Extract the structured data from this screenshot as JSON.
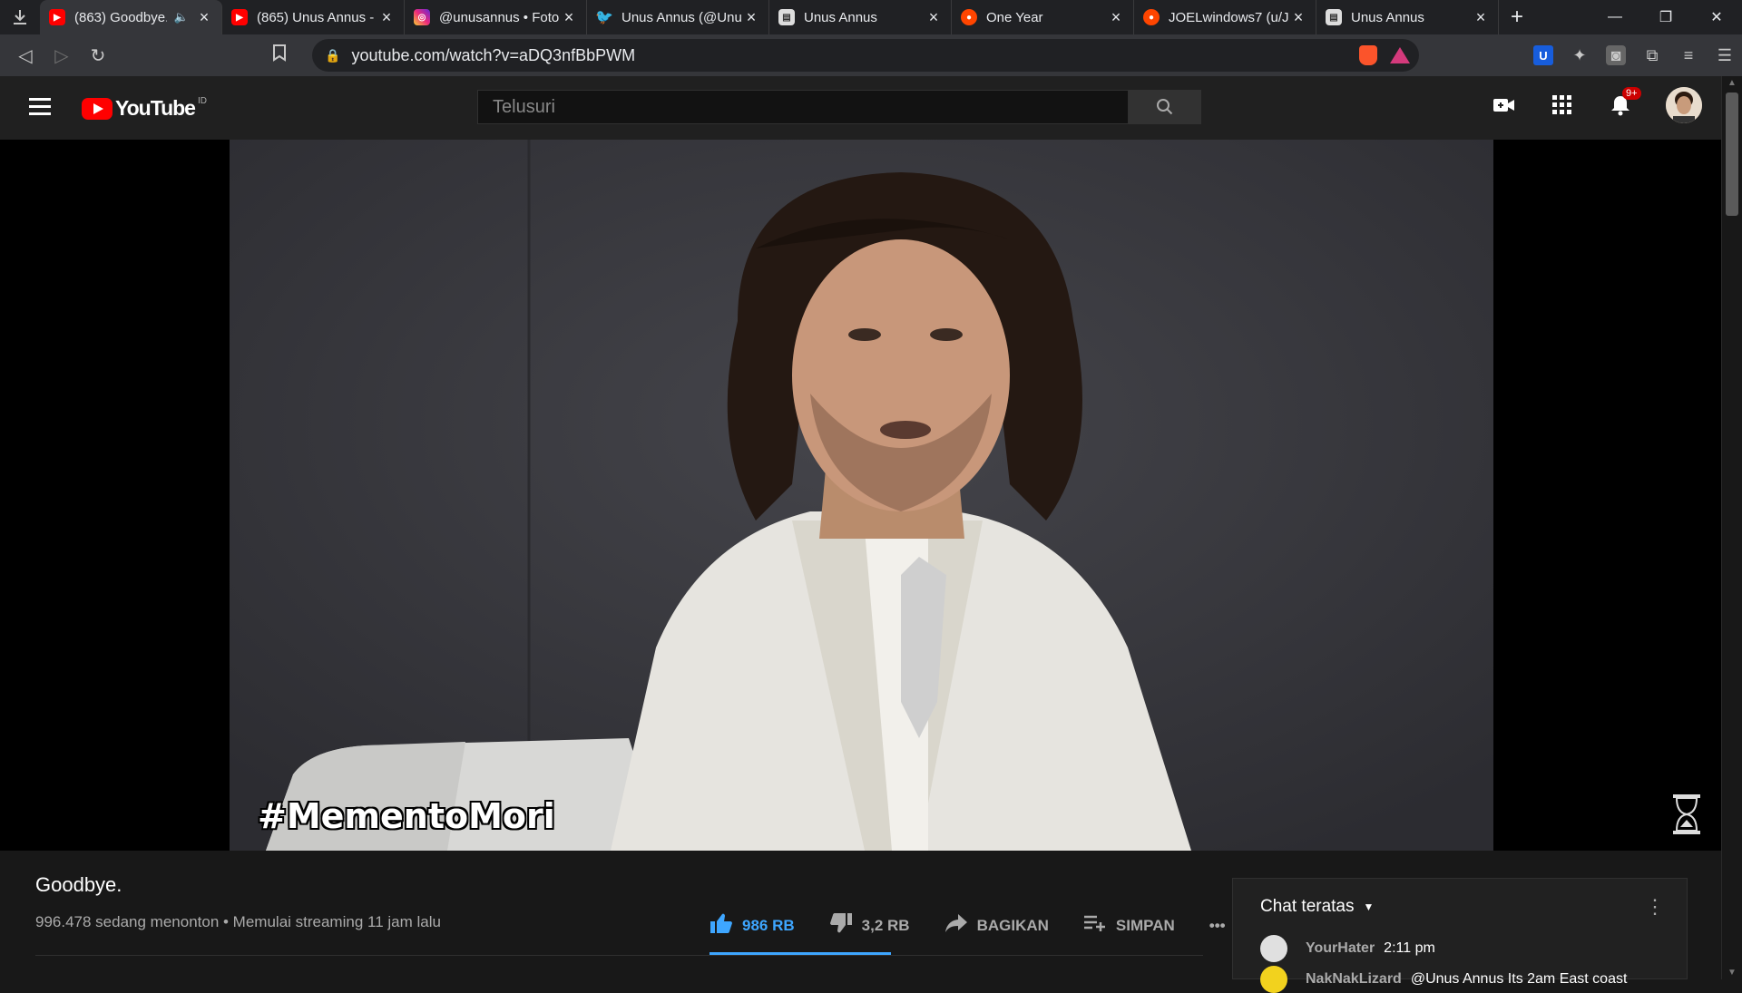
{
  "browser": {
    "tabs": [
      {
        "title": "(863) Goodbye.",
        "favicon": "youtube-icon",
        "color": "#ff0000",
        "active": true,
        "audio": true
      },
      {
        "title": "(865) Unus Annus -",
        "favicon": "youtube-icon",
        "color": "#ff0000"
      },
      {
        "title": "@unusannus • Foto",
        "favicon": "instagram-icon",
        "color": "#c13584"
      },
      {
        "title": "Unus Annus (@Unu",
        "favicon": "twitter-icon",
        "color": "#1da1f2"
      },
      {
        "title": "Unus Annus",
        "favicon": "page-icon",
        "color": "#9aa0a6"
      },
      {
        "title": "One Year",
        "favicon": "reddit-icon",
        "color": "#ff4500"
      },
      {
        "title": "JOELwindows7 (u/J",
        "favicon": "reddit-icon",
        "color": "#ff4500"
      },
      {
        "title": "Unus Annus",
        "favicon": "page-icon",
        "color": "#9aa0a6"
      }
    ],
    "url": "youtube.com/watch?v=aDQ3nfBbPWM"
  },
  "youtube": {
    "logo_text": "YouTube",
    "region": "ID",
    "search_placeholder": "Telusuri",
    "notification_count": "9+"
  },
  "video": {
    "overlay_hashtag": "#MementoMori",
    "title": "Goodbye.",
    "meta": "996.478 sedang menonton • Memulai streaming 11 jam lalu",
    "likes": "986 RB",
    "dislikes": "3,2 RB",
    "share_label": "BAGIKAN",
    "save_label": "SIMPAN",
    "more_label": "•••"
  },
  "chat": {
    "header": "Chat teratas",
    "messages": [
      {
        "user": "YourHater",
        "text": "2:11 pm",
        "avatar_color": "#e0e0e0"
      },
      {
        "user": "NakNakLizard",
        "text": "@Unus Annus Its 2am East coast",
        "avatar_color": "#f2d21e"
      }
    ]
  },
  "colors": {
    "accent_blue": "#3ea6ff",
    "youtube_red": "#ff0000"
  }
}
